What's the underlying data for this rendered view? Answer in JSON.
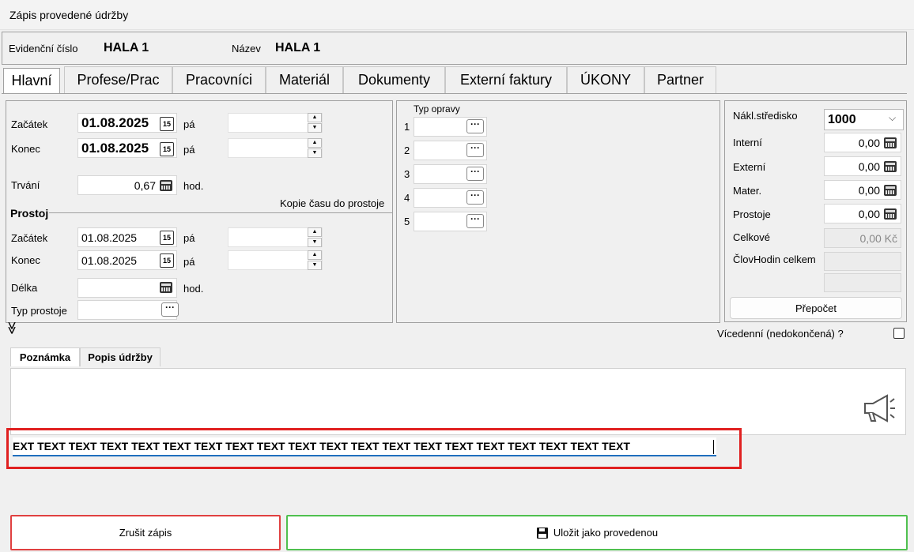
{
  "window": {
    "title": "Zápis provedené údržby"
  },
  "header": {
    "evid_label": "Evidenční číslo",
    "evid_value": "HALA 1",
    "name_label": "Název",
    "name_value": "HALA 1"
  },
  "tabs": [
    "Hlavní",
    "Profese/Prac",
    "Pracovníci",
    "Materiál",
    "Dokumenty",
    "Externí faktury",
    "ÚKONY",
    "Partner"
  ],
  "main": {
    "start_label": "Začátek",
    "start_date": "01.08.2025",
    "end_label": "Konec",
    "end_date": "01.08.2025",
    "day_label": "pá",
    "duration_label": "Trvání",
    "duration_value": "0,67",
    "hours_label": "hod.",
    "copy_label": "Kopie času do prostoje",
    "calendar_glyph": "15"
  },
  "downtime": {
    "group_label": "Prostoj",
    "start_label": "Začátek",
    "start_date": "01.08.2025",
    "end_label": "Konec",
    "end_date": "01.08.2025",
    "day_label": "pá",
    "length_label": "Délka",
    "hours_label": "hod.",
    "type_label": "Typ prostoje"
  },
  "repair": {
    "title": "Typ opravy",
    "rows": [
      "1",
      "2",
      "3",
      "4",
      "5"
    ],
    "dots": "···"
  },
  "costs": {
    "center_label": "Nákl.středisko",
    "center_value": "1000",
    "internal_label": "Interní",
    "internal_value": "0,00",
    "external_label": "Externí",
    "external_value": "0,00",
    "material_label": "Mater.",
    "material_value": "0,00",
    "downtime_label": "Prostoje",
    "downtime_value": "0,00",
    "total_label": "Celkové",
    "total_value": "0,00 Kč",
    "manhours_label": "ČlovHodin celkem",
    "recalc_button": "Přepočet"
  },
  "multiday_label": "Vícedenní (nedokončená) ?",
  "expand_glyph": "≫",
  "notes": {
    "tabs": [
      "Poznámka",
      "Popis údržby"
    ],
    "text": "EXT TEXT TEXT TEXT TEXT TEXT TEXT TEXT TEXT TEXT TEXT TEXT TEXT TEXT TEXT TEXT TEXT TEXT TEXT TEXT"
  },
  "footer": {
    "cancel_label": "Zrušit zápis",
    "save_label": "Uložit jako provedenou"
  },
  "colors": {
    "highlight": "#e02020",
    "cancel_border": "#e04040",
    "save_border": "#4fc04f",
    "text_underline": "#1f6fbd"
  }
}
